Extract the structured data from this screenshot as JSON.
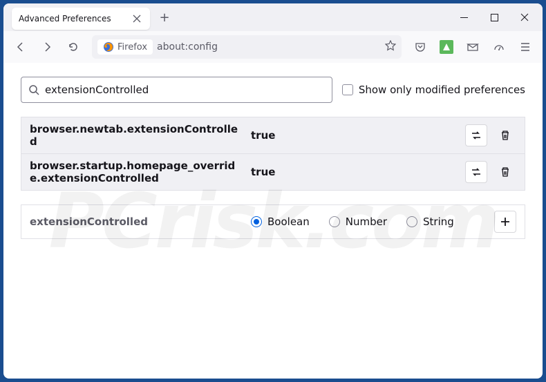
{
  "tab": {
    "title": "Advanced Preferences"
  },
  "urlbar": {
    "identity": "Firefox",
    "url": "about:config"
  },
  "search": {
    "value": "extensionControlled",
    "checkbox_label": "Show only modified preferences"
  },
  "prefs": [
    {
      "name": "browser.newtab.extensionControlled",
      "value": "true"
    },
    {
      "name": "browser.startup.homepage_override.extensionControlled",
      "value": "true"
    }
  ],
  "newpref": {
    "name": "extensionControlled",
    "types": [
      "Boolean",
      "Number",
      "String"
    ],
    "selected": 0
  },
  "watermark": "PCrisk.com"
}
